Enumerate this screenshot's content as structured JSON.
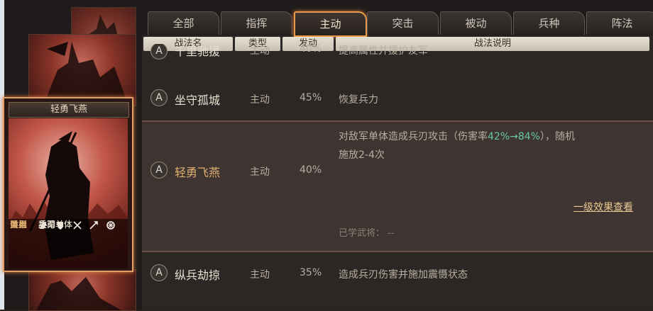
{
  "tabs": [
    {
      "label": "全部"
    },
    {
      "label": "指挥"
    },
    {
      "label": "主动"
    },
    {
      "label": "突击"
    },
    {
      "label": "被动"
    },
    {
      "label": "兵种"
    },
    {
      "label": "阵法"
    }
  ],
  "headers": {
    "name": "战法名",
    "type": "类型",
    "rate": "发动",
    "desc": "战法说明"
  },
  "rows": [
    {
      "badge": "A",
      "name": "千里驰援",
      "type": "主动",
      "rate": "40%",
      "desc": "提高属性并援护友军"
    },
    {
      "badge": "A",
      "name": "坐守孤城",
      "type": "主动",
      "rate": "45%",
      "desc": "恢复兵力"
    },
    {
      "badge": "A",
      "name": "轻勇飞燕",
      "type": "主动",
      "rate": "40%",
      "desc_line1_pre": "对敌军单体造成兵刃攻击（伤害率",
      "desc_hl": "42%→84%",
      "desc_line1_post": "），随机",
      "desc_line2": "施放2-4次",
      "link": "一级效果查看",
      "learned": "已学武将：  --"
    },
    {
      "badge": "A",
      "name": "纵兵劫掠",
      "type": "主动",
      "rate": "35%",
      "desc": "造成兵刃伤害并施加震慑状态"
    }
  ],
  "card": {
    "title": "轻勇飞燕",
    "use_label": "适用",
    "use_icons": [
      "cavalry-icon",
      "shield-icon",
      "bow-icon",
      "spear-icon",
      "wheel-icon"
    ],
    "type_label": "类型",
    "type_value": "主动",
    "effect_label": "效果",
    "effect_value": "兵刃单体",
    "target_label": "目标",
    "target_value": "敌军单体"
  },
  "colors": {
    "accent": "#e89a4a",
    "highlight": "#66c8a0",
    "name_selected": "#e0b070"
  }
}
